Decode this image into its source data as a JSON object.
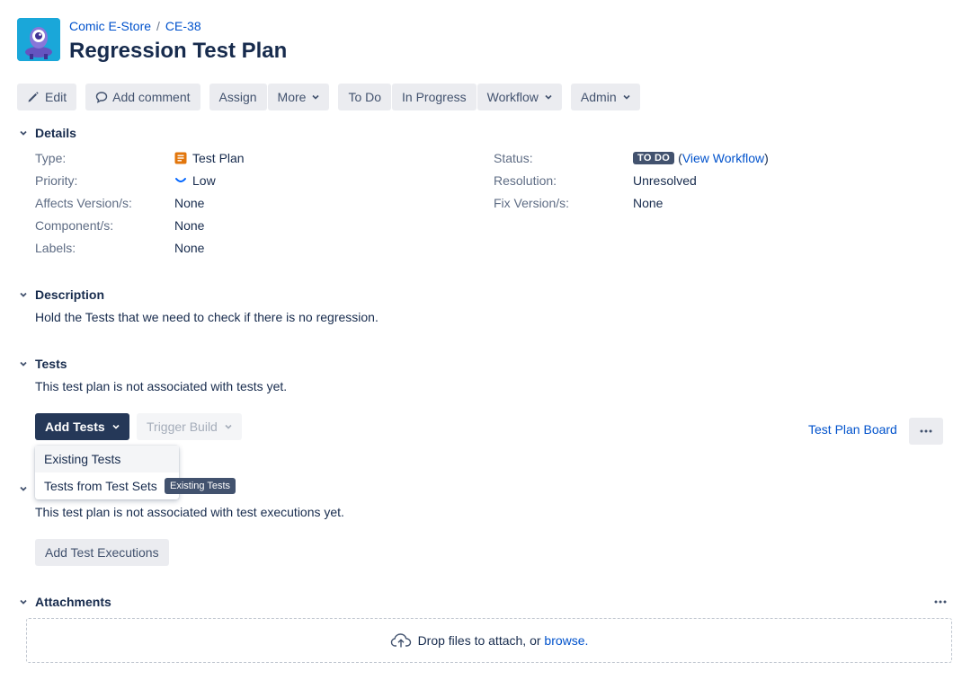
{
  "breadcrumb": {
    "project": "Comic E-Store",
    "separator": "/",
    "issue_key": "CE-38"
  },
  "page_title": "Regression Test Plan",
  "toolbar": {
    "edit": "Edit",
    "add_comment": "Add comment",
    "assign": "Assign",
    "more": "More",
    "to_do": "To Do",
    "in_progress": "In Progress",
    "workflow": "Workflow",
    "admin": "Admin"
  },
  "details": {
    "heading": "Details",
    "type_label": "Type:",
    "type_value": "Test Plan",
    "priority_label": "Priority:",
    "priority_value": "Low",
    "affects_label": "Affects Version/s:",
    "affects_value": "None",
    "component_label": "Component/s:",
    "component_value": "None",
    "labels_label": "Labels:",
    "labels_value": "None",
    "status_label": "Status:",
    "status_value": "TO DO",
    "view_workflow_open": "(",
    "view_workflow": "View Workflow",
    "view_workflow_close": ")",
    "resolution_label": "Resolution:",
    "resolution_value": "Unresolved",
    "fix_label": "Fix Version/s:",
    "fix_value": "None"
  },
  "description": {
    "heading": "Description",
    "text": "Hold the Tests that we need to check if there is no regression."
  },
  "tests": {
    "heading": "Tests",
    "empty_text": "This test plan is not associated with tests yet.",
    "add_tests": "Add Tests",
    "trigger_build": "Trigger Build",
    "board_link": "Test Plan Board",
    "dropdown_items": [
      "Existing Tests",
      "Tests from Test Sets"
    ],
    "tooltip": "Existing Tests"
  },
  "executions": {
    "empty_text": "This test plan is not associated with test executions yet.",
    "add_button": "Add Test Executions"
  },
  "attachments": {
    "heading": "Attachments",
    "drop_text": "Drop files to attach, or ",
    "browse": "browse."
  },
  "colors": {
    "link": "#0052cc",
    "primary_button": "#253858",
    "lozenge": "#42526e",
    "project_avatar": "#1aa7d9",
    "test_plan_icon": "#e2760c"
  }
}
